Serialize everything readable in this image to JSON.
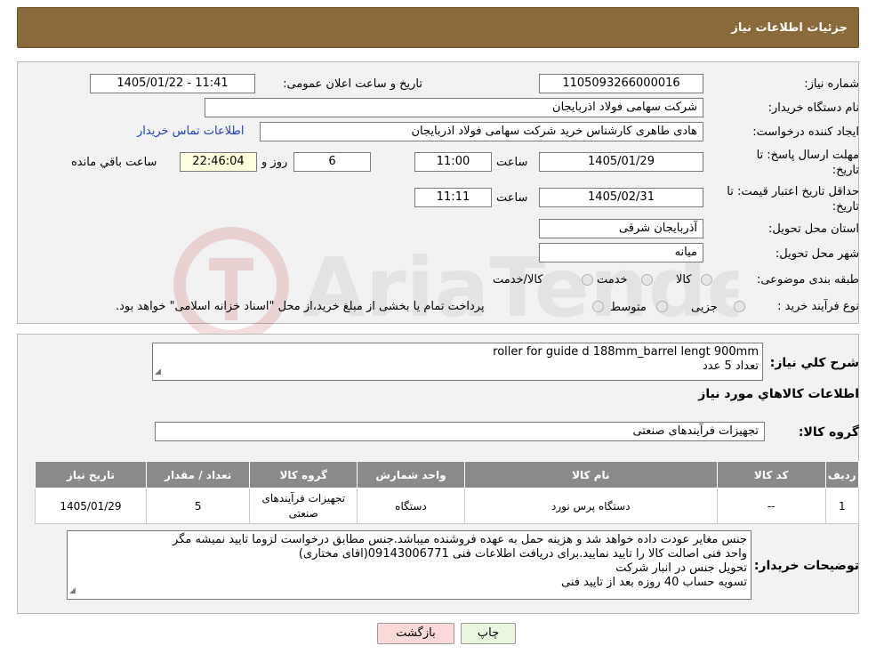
{
  "header": {
    "title": "جزئیات اطلاعات نیاز"
  },
  "form": {
    "need_number": {
      "label": "شماره نیاز:",
      "value": "1105093266000016"
    },
    "announce": {
      "label": "تاریخ و ساعت اعلان عمومی:",
      "value": "1405/01/22 - 11:41"
    },
    "buyer_org": {
      "label": "نام دستگاه خریدار:",
      "value": "شرکت سهامی فولاد اذربایجان"
    },
    "requester": {
      "label": "ایجاد کننده درخواست:",
      "value": "هادی طاهری کارشناس خرید شرکت سهامی فولاد اذربایجان",
      "contact_link": "اطلاعات تماس خریدار"
    },
    "deadline": {
      "label_line1": "مهلت ارسال پاسخ: تا",
      "label_line2": "تاریخ:",
      "date": "1405/01/29",
      "time_label": "ساعت",
      "time": "11:00",
      "days": "6",
      "days_label": "روز و",
      "remaining": "22:46:04",
      "remaining_label": "ساعت باقي مانده"
    },
    "validity": {
      "label_line1": "حداقل تاریخ اعتبار قیمت: تا",
      "label_line2": "تاریخ:",
      "date": "1405/02/31",
      "time_label": "ساعت",
      "time": "11:11"
    },
    "province": {
      "label": "استان محل تحویل:",
      "value": "آذربایجان شرقی"
    },
    "city": {
      "label": "شهر محل تحویل:",
      "value": "میانه"
    },
    "category": {
      "label": "طبقه بندی موضوعی:",
      "options": [
        "کالا",
        "خدمت",
        "کالا/خدمت"
      ]
    },
    "process": {
      "label": "نوع فرآیند خرید :",
      "options": [
        "جزیی",
        "متوسط"
      ],
      "note": "پرداخت تمام یا بخشی از مبلغ خرید،از محل \"اسناد خزانه اسلامی\" خواهد بود."
    }
  },
  "summary": {
    "label": "شرح کلي نياز:",
    "line1": "roller for guide d 188mm_barrel lengt 900mm",
    "line2": "تعداد 5 عدد"
  },
  "goods_info_title": "اطلاعات کالاهاي مورد نياز",
  "goods_group": {
    "label": "گروه کالا:",
    "value": "تجهیزات فرآیندهای صنعتی"
  },
  "table": {
    "headers": [
      "رديف",
      "کد کالا",
      "نام کالا",
      "واحد شمارش",
      "گروه کالا",
      "تعداد / مقدار",
      "تاریخ نیاز"
    ],
    "rows": [
      [
        "1",
        "--",
        "دستگاه پرس نورد",
        "دستگاه",
        "تجهیزات فرآیندهای صنعتی",
        "5",
        "1405/01/29"
      ]
    ]
  },
  "buyer_notes": {
    "label": "توضیحات خریدار:",
    "lines": [
      "جنس مغایر عودت داده خواهد شد و هزینه حمل به عهده فروشنده میباشد.جنس مطابق درخواست لزوما تایید نمیشه مگر",
      "واحد فنی اصالت کالا را تایید نمایید.برای دریافت اطلاعات فنی 09143006771(اقای مختاری)",
      "تحویل جنس در انبار شرکت",
      "تسویه حساب 40 روزه بعد از تایید فنی"
    ]
  },
  "buttons": {
    "print": "چاپ",
    "back": "بازگشت"
  },
  "colors": {
    "header_bg": "#8a6a3a",
    "table_header": "#8a8a8a",
    "back_btn": "#fbd9d9",
    "print_btn": "#e9f7e1"
  }
}
